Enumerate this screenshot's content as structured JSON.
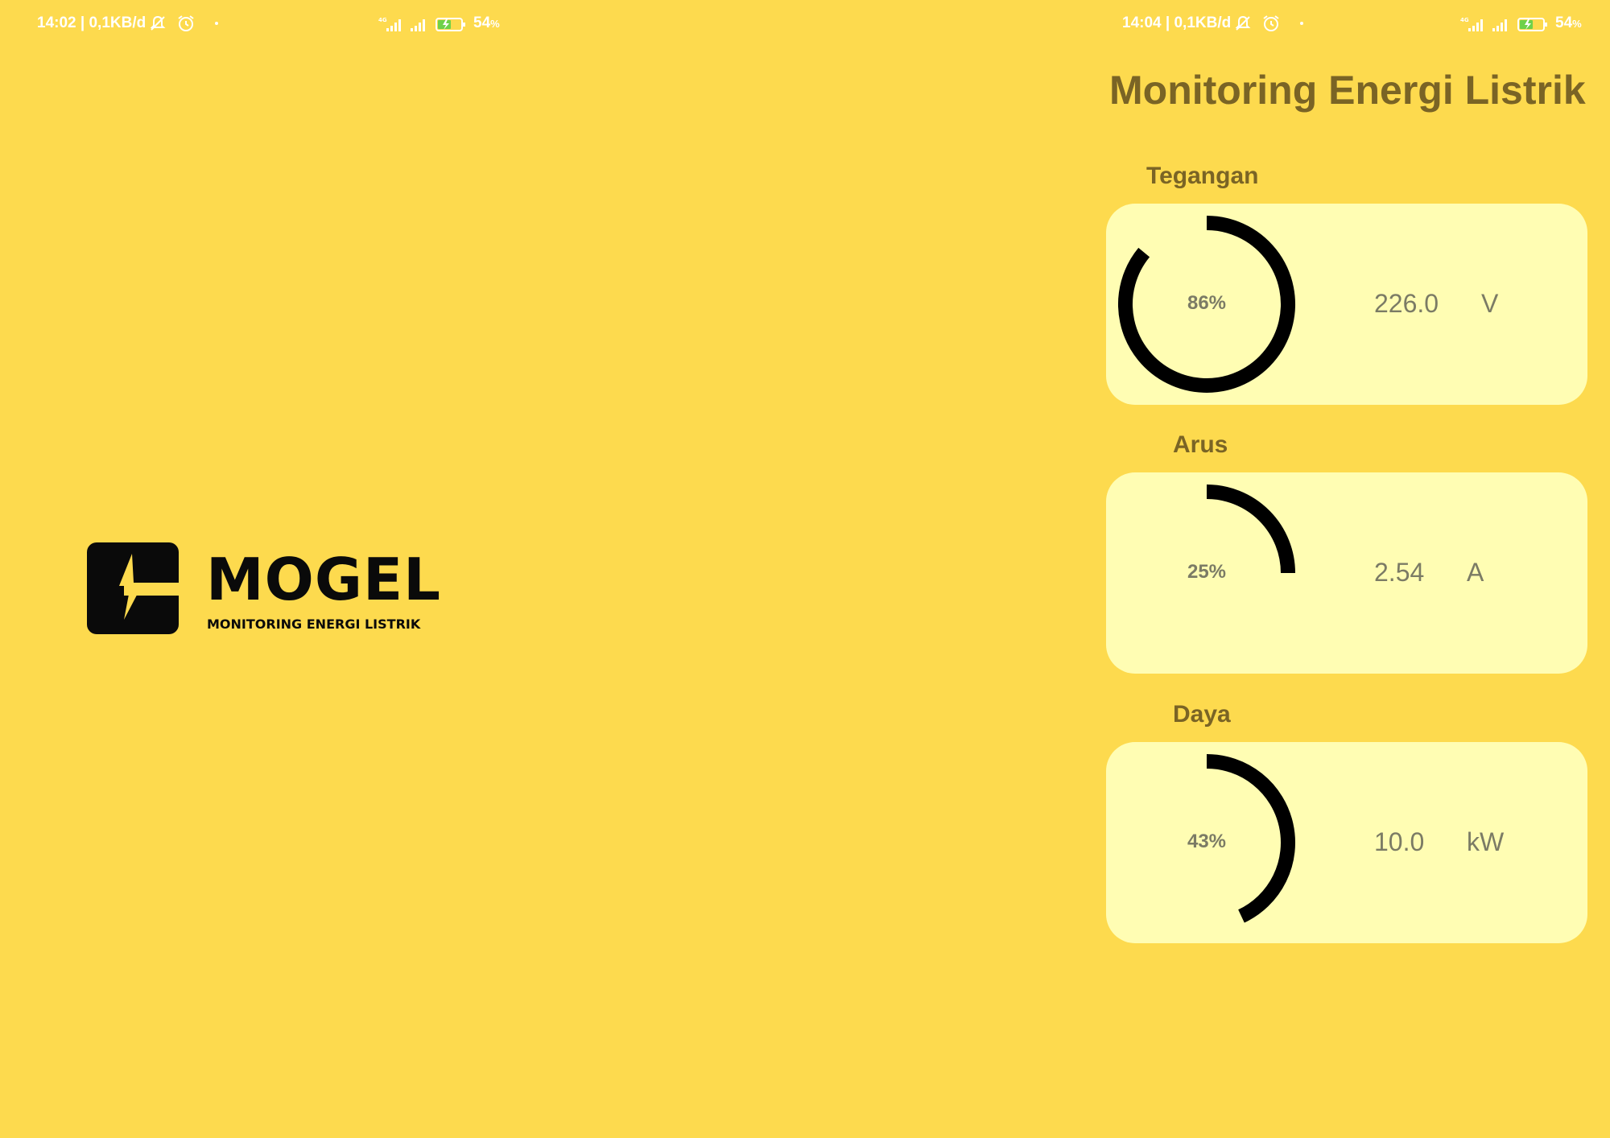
{
  "splash": {
    "status_bar": {
      "time_net": "14:02 | 0,1KB/d",
      "battery": "54"
    },
    "logo": {
      "name": "MOGEL",
      "tagline": "MONITORING ENERGI LISTRIK"
    }
  },
  "dashboard": {
    "status_bar": {
      "time_net": "14:04 | 0,1KB/d",
      "battery": "54"
    },
    "title": "Monitoring Energi Listrik",
    "cards": [
      {
        "label": "Tegangan",
        "percent_text": "86%",
        "percent": 86,
        "value": "226.0",
        "unit": "V"
      },
      {
        "label": "Arus",
        "percent_text": "25%",
        "percent": 25,
        "value": "2.54",
        "unit": "A"
      },
      {
        "label": "Daya",
        "percent_text": "43%",
        "percent": 43,
        "value": "10.0",
        "unit": "kW"
      }
    ]
  },
  "colors": {
    "background": "#FDDA4E",
    "card": "#FFFDB3",
    "title_text": "#7A6425",
    "gauge": "#000000"
  }
}
